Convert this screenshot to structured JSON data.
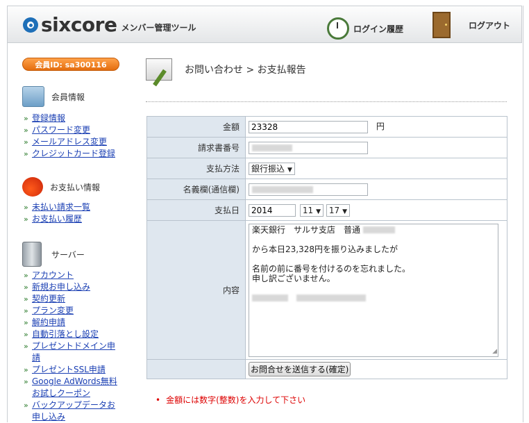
{
  "header": {
    "logo_text": "sixcore",
    "logo_subtitle": "メンバー管理ツール",
    "login_history": "ログイン履歴",
    "logout": "ログアウト"
  },
  "sidebar": {
    "member_id": "会員ID: sa300116",
    "sections": [
      {
        "title": "会員情報",
        "icon": "member-info-icon",
        "items": [
          "登録情報",
          "パスワード変更",
          "メールアドレス変更",
          "クレジットカード登録"
        ]
      },
      {
        "title": "お支払い情報",
        "icon": "payment-icon",
        "items": [
          "未払い請求一覧",
          "お支払い履歴"
        ]
      },
      {
        "title": "サーバー",
        "icon": "server-icon",
        "items": [
          "アカウント",
          "新規お申し込み",
          "契約更新",
          "プラン変更",
          "解約申請",
          "自動引落とし設定",
          "プレゼントドメイン申請",
          "プレゼントSSL申請",
          "Google AdWords無料お試しクーポン",
          "バックアップデータお申し込み"
        ]
      }
    ]
  },
  "main": {
    "breadcrumb": "お問い合わせ > お支払報告",
    "form": {
      "amount_label": "金額",
      "amount_value": "23328",
      "amount_unit": "円",
      "invoice_label": "請求書番号",
      "method_label": "支払方法",
      "method_value": "銀行振込",
      "name_label": "名義欄(通信欄)",
      "date_label": "支払日",
      "date_year": "2014",
      "date_month": "11",
      "date_day": "17",
      "content_label": "内容",
      "content_lines": [
        "楽天銀行　サルサ支店　普通",
        "",
        "から本日23,328円を振り込みましたが",
        "",
        "名前の前に番号を付けるのを忘れました。",
        "申し訳ございません。"
      ],
      "submit": "お問合せを送信する(確定)"
    },
    "error": "金額には数字(整数)を入力して下さい"
  }
}
